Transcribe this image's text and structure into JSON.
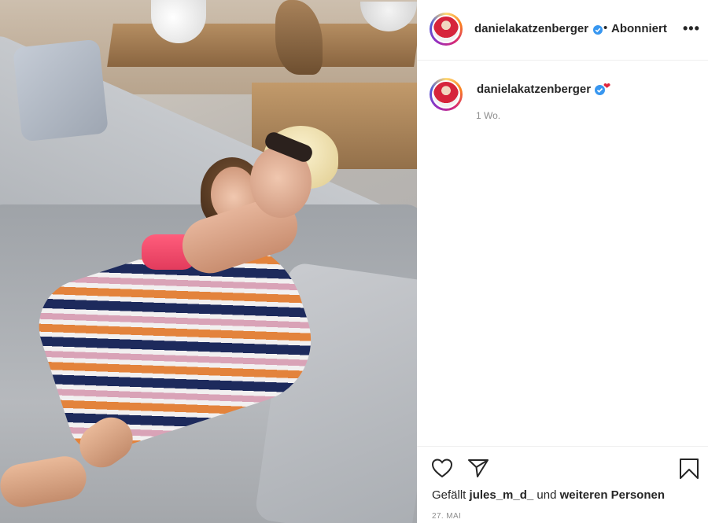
{
  "post": {
    "username": "danielakatzenberger",
    "follow_status": "Abonniert",
    "separator": "•",
    "more": "•••",
    "caption_emoji": "❤",
    "time_ago": "1 Wo.",
    "likes": {
      "prefix": "Gefällt",
      "first_user": "jules_m_d_",
      "connector": "und",
      "others": "weiteren Personen"
    },
    "date": "27. MAI"
  },
  "icons": {
    "like": "heart-icon",
    "share": "send-icon",
    "save": "bookmark-icon",
    "verified": "verified-badge-icon"
  },
  "colors": {
    "verified": "#3897f0",
    "text": "#262626",
    "muted": "#8e8e8e"
  }
}
